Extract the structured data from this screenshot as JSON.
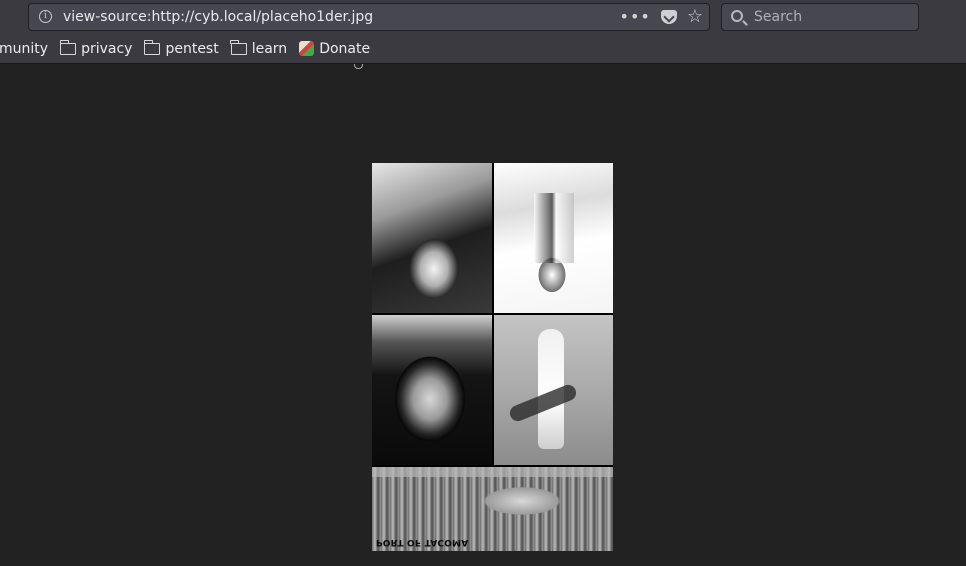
{
  "browser": {
    "url": "view-source:http://cyb.local/placeho1der.jpg",
    "search_placeholder": "Search",
    "page_actions": "•••"
  },
  "bookmarks": [
    {
      "label": "munity",
      "icon": "folder-icon"
    },
    {
      "label": "privacy",
      "icon": "folder-icon"
    },
    {
      "label": "pentest",
      "icon": "folder-icon"
    },
    {
      "label": "learn",
      "icon": "folder-icon"
    },
    {
      "label": "Donate",
      "icon": "donate-icon"
    }
  ],
  "image": {
    "caption": "PORT OF TACOMA",
    "tiles": 5,
    "style": "inverted grayscale collage, upside down"
  },
  "colors": {
    "toolbar": "#3a3a40",
    "viewport": "#222223",
    "urlbar": "#474750"
  }
}
